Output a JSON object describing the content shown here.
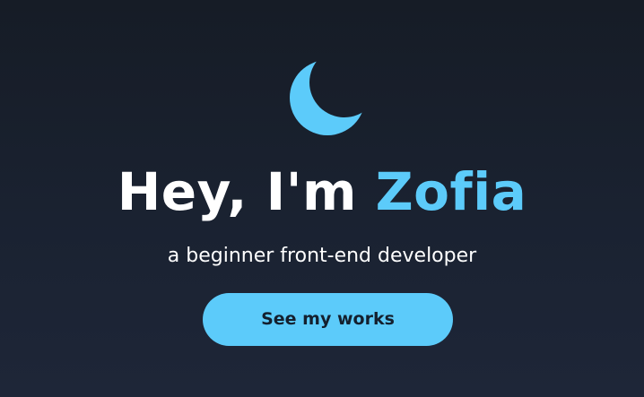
{
  "hero": {
    "icon": "crescent-moon-icon",
    "greeting": "Hey, I'm",
    "name": "Zofia",
    "subtitle": "a beginner front-end developer",
    "cta_label": "See my works"
  },
  "colors": {
    "accent": "#5ccbfa",
    "background": "#1a2231",
    "title_text": "#ffffff",
    "button_text": "#14202e"
  }
}
